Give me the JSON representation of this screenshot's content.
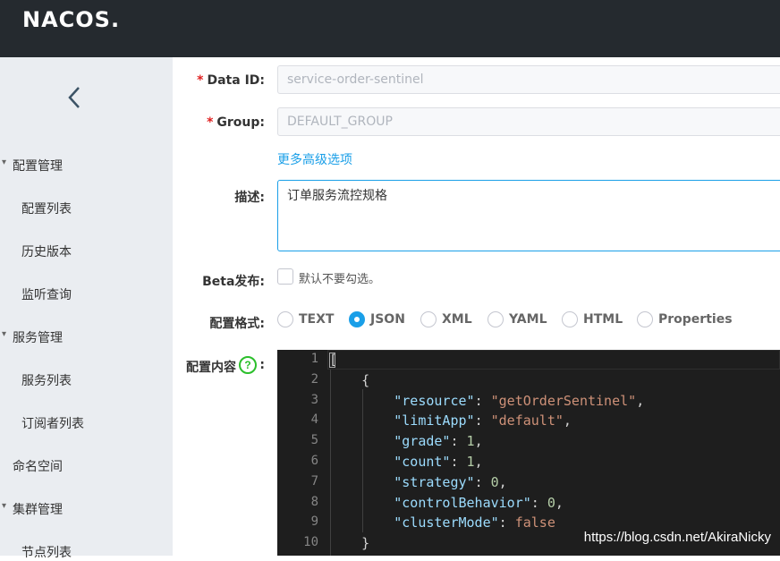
{
  "app": {
    "logo_text": "NACOS."
  },
  "sidebar": {
    "collapse_icon": "chevron-left-icon",
    "groups": [
      {
        "label": "配置管理",
        "items": [
          "配置列表",
          "历史版本",
          "监听查询"
        ]
      },
      {
        "label": "服务管理",
        "items": [
          "服务列表",
          "订阅者列表"
        ]
      },
      {
        "label": "命名空间",
        "items": []
      },
      {
        "label": "集群管理",
        "items": [
          "节点列表"
        ]
      }
    ]
  },
  "form": {
    "data_id": {
      "label": "Data ID:",
      "value": "service-order-sentinel"
    },
    "group": {
      "label": "Group:",
      "value": "DEFAULT_GROUP"
    },
    "advanced_link": "更多高级选项",
    "description": {
      "label": "描述:",
      "value": "订单服务流控规格"
    },
    "beta": {
      "label": "Beta发布:",
      "checkbox_text": "默认不要勾选。",
      "checked": false
    },
    "format": {
      "label": "配置格式:",
      "options": [
        "TEXT",
        "JSON",
        "XML",
        "YAML",
        "HTML",
        "Properties"
      ],
      "selected": "JSON"
    },
    "content": {
      "label": "配置内容",
      "colon": ":"
    }
  },
  "editor": {
    "line_numbers": [
      "1",
      "2",
      "3",
      "4",
      "5",
      "6",
      "7",
      "8",
      "9",
      "10"
    ],
    "lines": [
      [
        {
          "t": "[",
          "c": ""
        }
      ],
      [
        {
          "t": "    {",
          "c": ""
        }
      ],
      [
        {
          "t": "        ",
          "c": ""
        },
        {
          "t": "\"resource\"",
          "c": "k"
        },
        {
          "t": ": ",
          "c": ""
        },
        {
          "t": "\"getOrderSentinel\"",
          "c": "s"
        },
        {
          "t": ",",
          "c": ""
        }
      ],
      [
        {
          "t": "        ",
          "c": ""
        },
        {
          "t": "\"limitApp\"",
          "c": "k"
        },
        {
          "t": ": ",
          "c": ""
        },
        {
          "t": "\"default\"",
          "c": "s"
        },
        {
          "t": ",",
          "c": ""
        }
      ],
      [
        {
          "t": "        ",
          "c": ""
        },
        {
          "t": "\"grade\"",
          "c": "k"
        },
        {
          "t": ": ",
          "c": ""
        },
        {
          "t": "1",
          "c": "n"
        },
        {
          "t": ",",
          "c": ""
        }
      ],
      [
        {
          "t": "        ",
          "c": ""
        },
        {
          "t": "\"count\"",
          "c": "k"
        },
        {
          "t": ": ",
          "c": ""
        },
        {
          "t": "1",
          "c": "n"
        },
        {
          "t": ",",
          "c": ""
        }
      ],
      [
        {
          "t": "        ",
          "c": ""
        },
        {
          "t": "\"strategy\"",
          "c": "k"
        },
        {
          "t": ": ",
          "c": ""
        },
        {
          "t": "0",
          "c": "n"
        },
        {
          "t": ",",
          "c": ""
        }
      ],
      [
        {
          "t": "        ",
          "c": ""
        },
        {
          "t": "\"controlBehavior\"",
          "c": "k"
        },
        {
          "t": ": ",
          "c": ""
        },
        {
          "t": "0",
          "c": "n"
        },
        {
          "t": ",",
          "c": ""
        }
      ],
      [
        {
          "t": "        ",
          "c": ""
        },
        {
          "t": "\"clusterMode\"",
          "c": "k"
        },
        {
          "t": ": ",
          "c": ""
        },
        {
          "t": "false",
          "c": "b"
        }
      ],
      [
        {
          "t": "    }",
          "c": ""
        }
      ]
    ]
  },
  "watermark": "https://blog.csdn.net/AkiraNicky",
  "colors": {
    "accent": "#1a9fe8",
    "topbar": "#252a2f",
    "sidebar": "#eaedf1",
    "editor_bg": "#1e1e1e"
  }
}
